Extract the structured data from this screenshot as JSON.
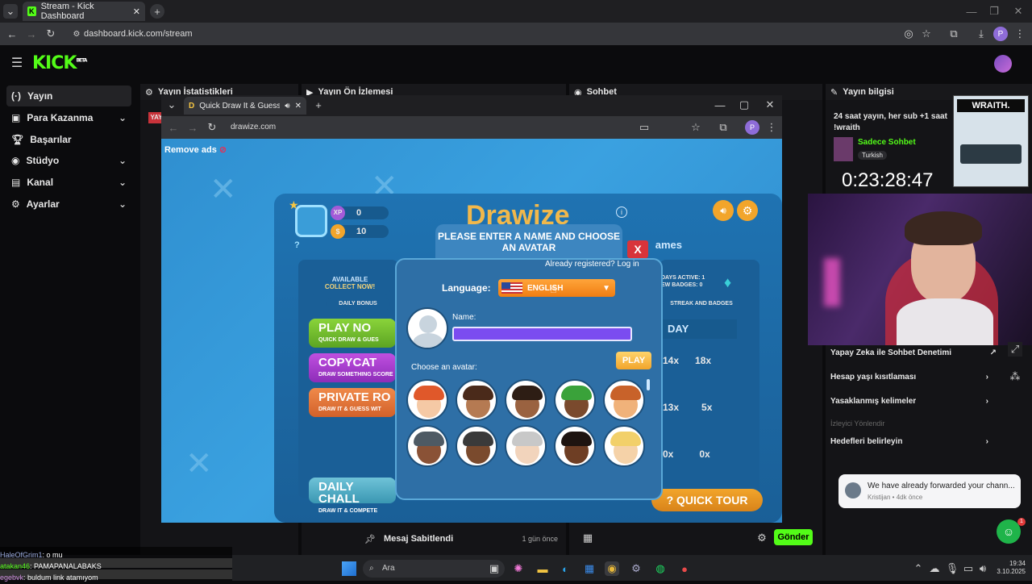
{
  "browser": {
    "tab_title": "Stream - Kick Dashboard",
    "url": "dashboard.kick.com/stream"
  },
  "kick": {
    "logo": "KICK",
    "beta": "BETA"
  },
  "sidebar": {
    "items": [
      {
        "label": "Yayın",
        "icon": "broadcast-icon"
      },
      {
        "label": "Para Kazanma",
        "icon": "money-icon"
      },
      {
        "label": "Başarılar",
        "icon": "trophy-icon"
      },
      {
        "label": "Stüdyo",
        "icon": "studio-icon"
      },
      {
        "label": "Kanal",
        "icon": "channel-icon"
      },
      {
        "label": "Ayarlar",
        "icon": "gear-icon"
      }
    ]
  },
  "panels": {
    "stats": "Yayın İstatistikleri",
    "preview": "Yayın Ön İzlemesi",
    "chat": "Sohbet",
    "info": "Yayın bilgisi"
  },
  "inner_browser": {
    "tab_title": "Quick Draw It & Guess",
    "url": "drawize.com"
  },
  "game": {
    "remove_ads": "Remove ads",
    "xp_label": "XP",
    "xp_value": "0",
    "coins_value": "10",
    "help": "?",
    "modal_title": "PLEASE ENTER A NAME AND CHOOSE AN AVATAR",
    "close": "X",
    "already_registered": "Already registered? Log in",
    "language_label": "Language:",
    "language_value": "ENGLISH",
    "name_label": "Name:",
    "play": "PLAY",
    "choose_avatar": "Choose an avatar:",
    "games_word": "ames",
    "available": "AVAILABLE",
    "collect_now": "COLLECT NOW!",
    "daily_bonus": "DAILY BONUS",
    "days_active": "DAYS ACTIVE: 1",
    "new_badges": "EW BADGES: 0",
    "streak": "STREAK AND BADGES",
    "today": "DAY",
    "buttons": [
      {
        "title": "PLAY NO",
        "sub": "QUICK DRAW & GUES"
      },
      {
        "title": "COPYCAT",
        "sub": "DRAW SOMETHING SCORE"
      },
      {
        "title": "PRIVATE RO",
        "sub": "DRAW IT & GUESS WIT"
      }
    ],
    "daily_challenge": "DAILY CHALL",
    "daily_challenge_sub": "DRAW IT & COMPETE",
    "quick_tour": "QUICK TOUR",
    "scores": [
      {
        "a": "14x",
        "b": "18x"
      },
      {
        "a": "13x",
        "b": "5x"
      },
      {
        "a": "0x",
        "b": "0x"
      }
    ]
  },
  "info": {
    "title": "24 saat yayın, her sub +1 saat",
    "command": "!wraith",
    "category": "Sadece Sohbet",
    "tag": "Turkish",
    "timer": "0:23:28:47",
    "ad_brand": "WRAITH.",
    "settings": [
      "Yapay Zeka ile Sohbet Denetimi",
      "Hesap yaşı kısıtlaması",
      "Yasaklanmış kelimeler",
      "İzleyici Yönlendir",
      "Hedefleri belirleyin"
    ]
  },
  "toast": {
    "text": "We have already forwarded your chann...",
    "meta": "Kristijan • 4dk önce"
  },
  "chat_panel": {
    "pinned": "Mesaj Sabitlendi",
    "pinned_time": "1 gün önce",
    "send": "Gönder"
  },
  "overlay_chat": [
    {
      "user": "HaleOfGrim1",
      "msg": ": o mu"
    },
    {
      "user": "atakan46",
      "msg": ": PAMAPANALABAKS"
    },
    {
      "user": "egebvk",
      "msg": ": buldum link atamıyom"
    }
  ],
  "taskbar": {
    "search": "Ara",
    "time": "19:34",
    "date": "3.10.2025"
  },
  "colors": {
    "kick_green": "#53fc18",
    "game_blue": "#2f8fd0",
    "send_green": "#53fc18"
  }
}
